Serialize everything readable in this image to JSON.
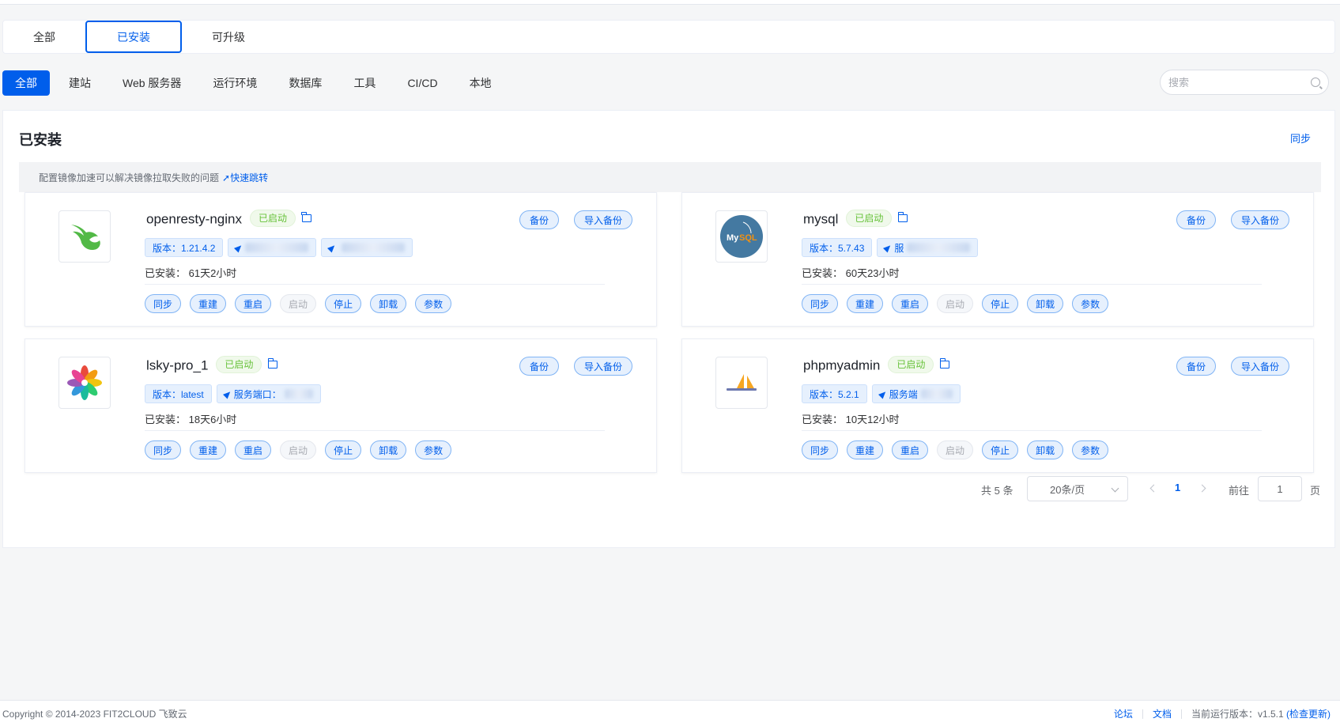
{
  "status_tabs": [
    "全部",
    "已安装",
    "可升级"
  ],
  "categories": [
    "全部",
    "建站",
    "Web 服务器",
    "运行环境",
    "数据库",
    "工具",
    "CI/CD",
    "本地"
  ],
  "search": {
    "placeholder": "搜索"
  },
  "section": {
    "title": "已安装",
    "sync": "同步",
    "notice": "配置镜像加速可以解决镜像拉取失败的问题",
    "notice_link": "快速跳转"
  },
  "buttons": {
    "backup": "备份",
    "import_backup": "导入备份",
    "sync": "同步",
    "rebuild": "重建",
    "restart": "重启",
    "start": "启动",
    "stop": "停止",
    "uninstall": "卸载",
    "params": "参数"
  },
  "apps": [
    {
      "name": "openresty-nginx",
      "status": "已启动",
      "version": "版本：1.21.4.2",
      "port": "",
      "installed": "已安装：  61天2小时"
    },
    {
      "name": "mysql",
      "status": "已启动",
      "version": "版本：5.7.43",
      "port": "服",
      "installed": "已安装：  60天23小时"
    },
    {
      "name": "lsky-pro_1",
      "status": "已启动",
      "version": "版本：latest",
      "port": "服务端口：",
      "installed": "已安装：  18天6小时"
    },
    {
      "name": "phpmyadmin",
      "status": "已启动",
      "version": "版本：5.2.1",
      "port": "服务端",
      "installed": "已安装：  10天12小时"
    }
  ],
  "pagination": {
    "total": "共 5 条",
    "page_size": "20条/页",
    "current_page": "1",
    "goto_label": "前往",
    "goto_value": "1",
    "page_unit": "页"
  },
  "footer": {
    "copyright": "Copyright © 2014-2023 FIT2CLOUD 飞致云",
    "forum": "论坛",
    "docs": "文档",
    "version": "当前运行版本：v1.5.1",
    "check_update": "(检查更新)"
  },
  "colors": {
    "primary": "#005eeb",
    "success": "#67c23a"
  }
}
